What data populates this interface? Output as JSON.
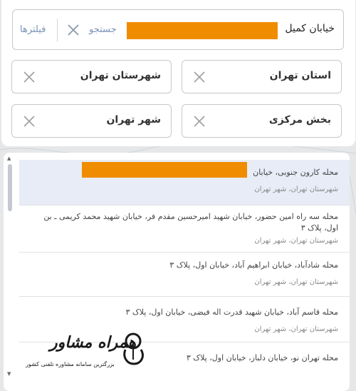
{
  "search": {
    "value": "خیابان کمیل",
    "search_label": "جستجو",
    "filters_label": "فیلترها"
  },
  "chips": [
    {
      "label": "استان تهران"
    },
    {
      "label": "شهرستان تهران"
    },
    {
      "label": "بخش مرکزی"
    },
    {
      "label": "شهر تهران"
    }
  ],
  "results": [
    {
      "title": "محله کارون جنوبی، خیابان",
      "subtitle": "شهرستان تهران، شهر تهران"
    },
    {
      "title": "محله سه راه امین حضور، خیابان شهید امیرحسین مقدم فر، خیابان شهید محمد کریمی ـ بن اول، پلاک ۳",
      "subtitle": "شهرستان تهران، شهر تهران"
    },
    {
      "title": "محله شادآباد، خیابان ابراهیم آباد، خیابان اول، پلاک ۳",
      "subtitle": "شهرستان تهران، شهر تهران"
    },
    {
      "title": "محله قاسم آباد، خیابان شهید قدرت اله فیضی، خیابان اول، پلاک ۳",
      "subtitle": "شهرستان تهران، شهر تهران"
    },
    {
      "title": "محله تهران نو، خیابان دلباز، خیابان اول، پلاک ۳",
      "subtitle": ""
    }
  ],
  "logo": {
    "name": "همراه مشاور",
    "tagline": "بزرگترین سامانه مشاوره تلفنی کشور"
  },
  "colors": {
    "accent": "#7a93b8",
    "redaction": "#f08c00",
    "selected_row": "#e7ecf6"
  }
}
